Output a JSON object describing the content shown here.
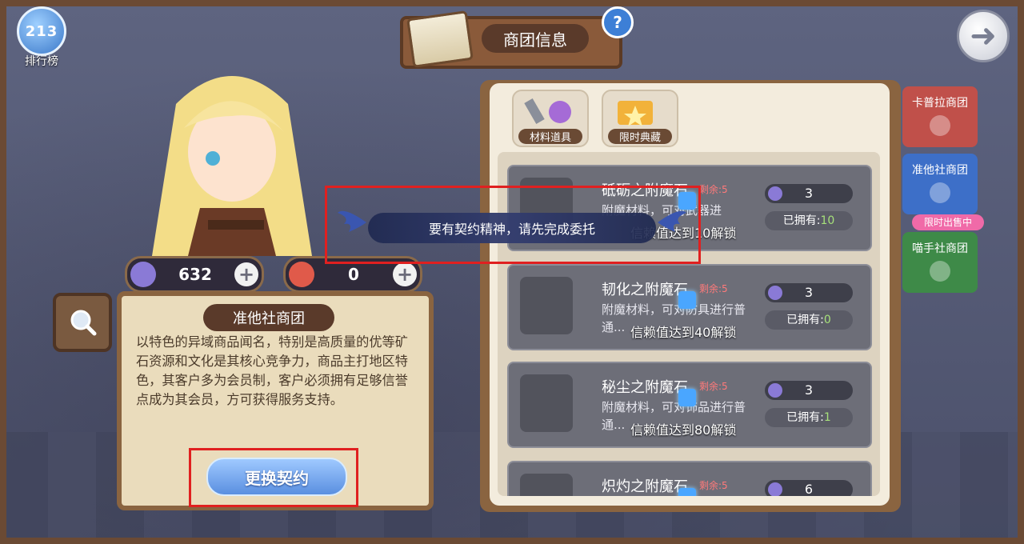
{
  "top": {
    "ranking_label": "排行榜",
    "ranking_icon_text": "213",
    "title": "商团信息",
    "help_label": "?"
  },
  "currencies": [
    {
      "icon": "purple-gem-icon",
      "value": "632"
    },
    {
      "icon": "heart-medal-icon",
      "value": "0"
    }
  ],
  "guild": {
    "name": "准他社商团",
    "description": "以特色的异域商品闻名，特别是高质量的优等矿石资源和文化是其核心竞争力，商品主打地区特色，其客户多为会员制，客户必须拥有足够信誉点成为其会员，方可获得服务支持。",
    "change_button": "更换契约"
  },
  "tabs": [
    {
      "label": "材料道具",
      "icon": "tools-potion-icon"
    },
    {
      "label": "限时典藏",
      "icon": "folder-star-icon"
    }
  ],
  "items": [
    {
      "name": "砥砺之附魔石",
      "remain": "剩余:5",
      "desc": "附魔材料，可对武器进",
      "unlock": "信赖值达到10解锁",
      "price": "3",
      "owned_label": "已拥有:",
      "owned": "10"
    },
    {
      "name": "韧化之附魔石",
      "remain": "剩余:5",
      "desc": "附魔材料，可对防具进行普通...",
      "unlock": "信赖值达到40解锁",
      "price": "3",
      "owned_label": "已拥有:",
      "owned": "0"
    },
    {
      "name": "秘尘之附魔石",
      "remain": "剩余:5",
      "desc": "附魔材料，可对饰品进行普通...",
      "unlock": "信赖值达到80解锁",
      "price": "3",
      "owned_label": "已拥有:",
      "owned": "1"
    },
    {
      "name": "炽灼之附魔石",
      "remain": "剩余:5",
      "desc": "",
      "unlock": "",
      "price": "6",
      "owned_label": "",
      "owned": ""
    }
  ],
  "side_tabs": [
    {
      "label": "卡普拉商团",
      "color": "#c0504a"
    },
    {
      "label": "准他社商团",
      "color": "#3d6fc8",
      "badge": "限时出售中"
    },
    {
      "label": "喵手社商团",
      "color": "#3e8a48"
    }
  ],
  "toast": {
    "text": "要有契约精神，请先完成委托"
  }
}
